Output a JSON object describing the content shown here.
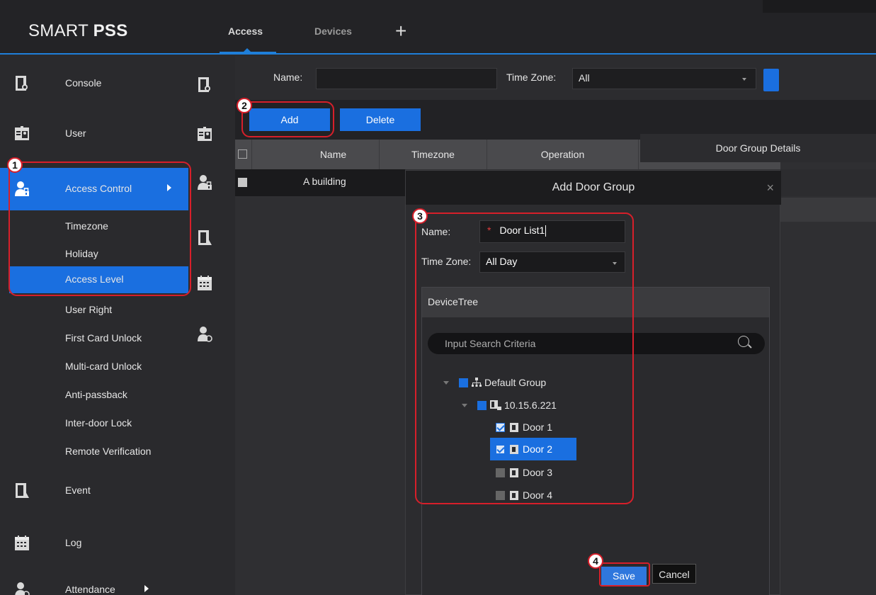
{
  "app": {
    "logo_plain": "SMART ",
    "logo_bold": "PSS",
    "tabs": [
      {
        "label": "Access"
      },
      {
        "label": "Devices"
      }
    ],
    "add_tab_symbol": "+"
  },
  "nav": {
    "items": [
      {
        "label": "Console",
        "icon": "console-door-icon"
      },
      {
        "label": "User",
        "icon": "user-card-icon"
      },
      {
        "label": "Access Control",
        "icon": "access-control-icon",
        "active": true
      },
      {
        "label": "Event",
        "icon": "event-door-icon"
      },
      {
        "label": "Log",
        "icon": "calendar-log-icon"
      },
      {
        "label": "Attendance",
        "icon": "attendance-icon"
      }
    ],
    "sub_items": [
      {
        "label": "Timezone"
      },
      {
        "label": "Holiday"
      },
      {
        "label": "Access Level",
        "active": true
      },
      {
        "label": "User Right"
      },
      {
        "label": "First Card Unlock"
      },
      {
        "label": "Multi-card Unlock"
      },
      {
        "label": "Anti-passback"
      },
      {
        "label": "Inter-door Lock"
      },
      {
        "label": "Remote Verification"
      }
    ]
  },
  "filter": {
    "name_label": "Name:",
    "name_value": "",
    "timezone_label": "Time Zone:",
    "timezone_value": "All"
  },
  "toolbar": {
    "add_label": "Add",
    "delete_label": "Delete"
  },
  "table": {
    "columns": [
      "Name",
      "Timezone",
      "Operation"
    ],
    "extra_column": "Door Group Details",
    "rows": [
      {
        "name": "A building"
      }
    ]
  },
  "modal": {
    "title": "Add Door Group",
    "close_symbol": "×",
    "name_label": "Name:",
    "required_mark": "*",
    "name_value": "Door  List1",
    "timezone_label": "Time Zone:",
    "timezone_value": "All Day",
    "devicetree_label": "DeviceTree",
    "search_placeholder": "Input Search Criteria",
    "tree": {
      "group": "Default Group",
      "device": "10.15.6.221",
      "doors": [
        {
          "label": "Door 1",
          "checked": true
        },
        {
          "label": "Door 2",
          "checked": true,
          "selected": true
        },
        {
          "label": "Door 3",
          "checked": false
        },
        {
          "label": "Door 4",
          "checked": false
        }
      ]
    },
    "save_label": "Save",
    "cancel_label": "Cancel"
  },
  "annotations": {
    "badges": [
      "1",
      "2",
      "3",
      "4"
    ],
    "color": "#d71f2a"
  },
  "colors": {
    "accent": "#1a6fe0",
    "background": "#2a2a2d",
    "header": "#232326"
  }
}
